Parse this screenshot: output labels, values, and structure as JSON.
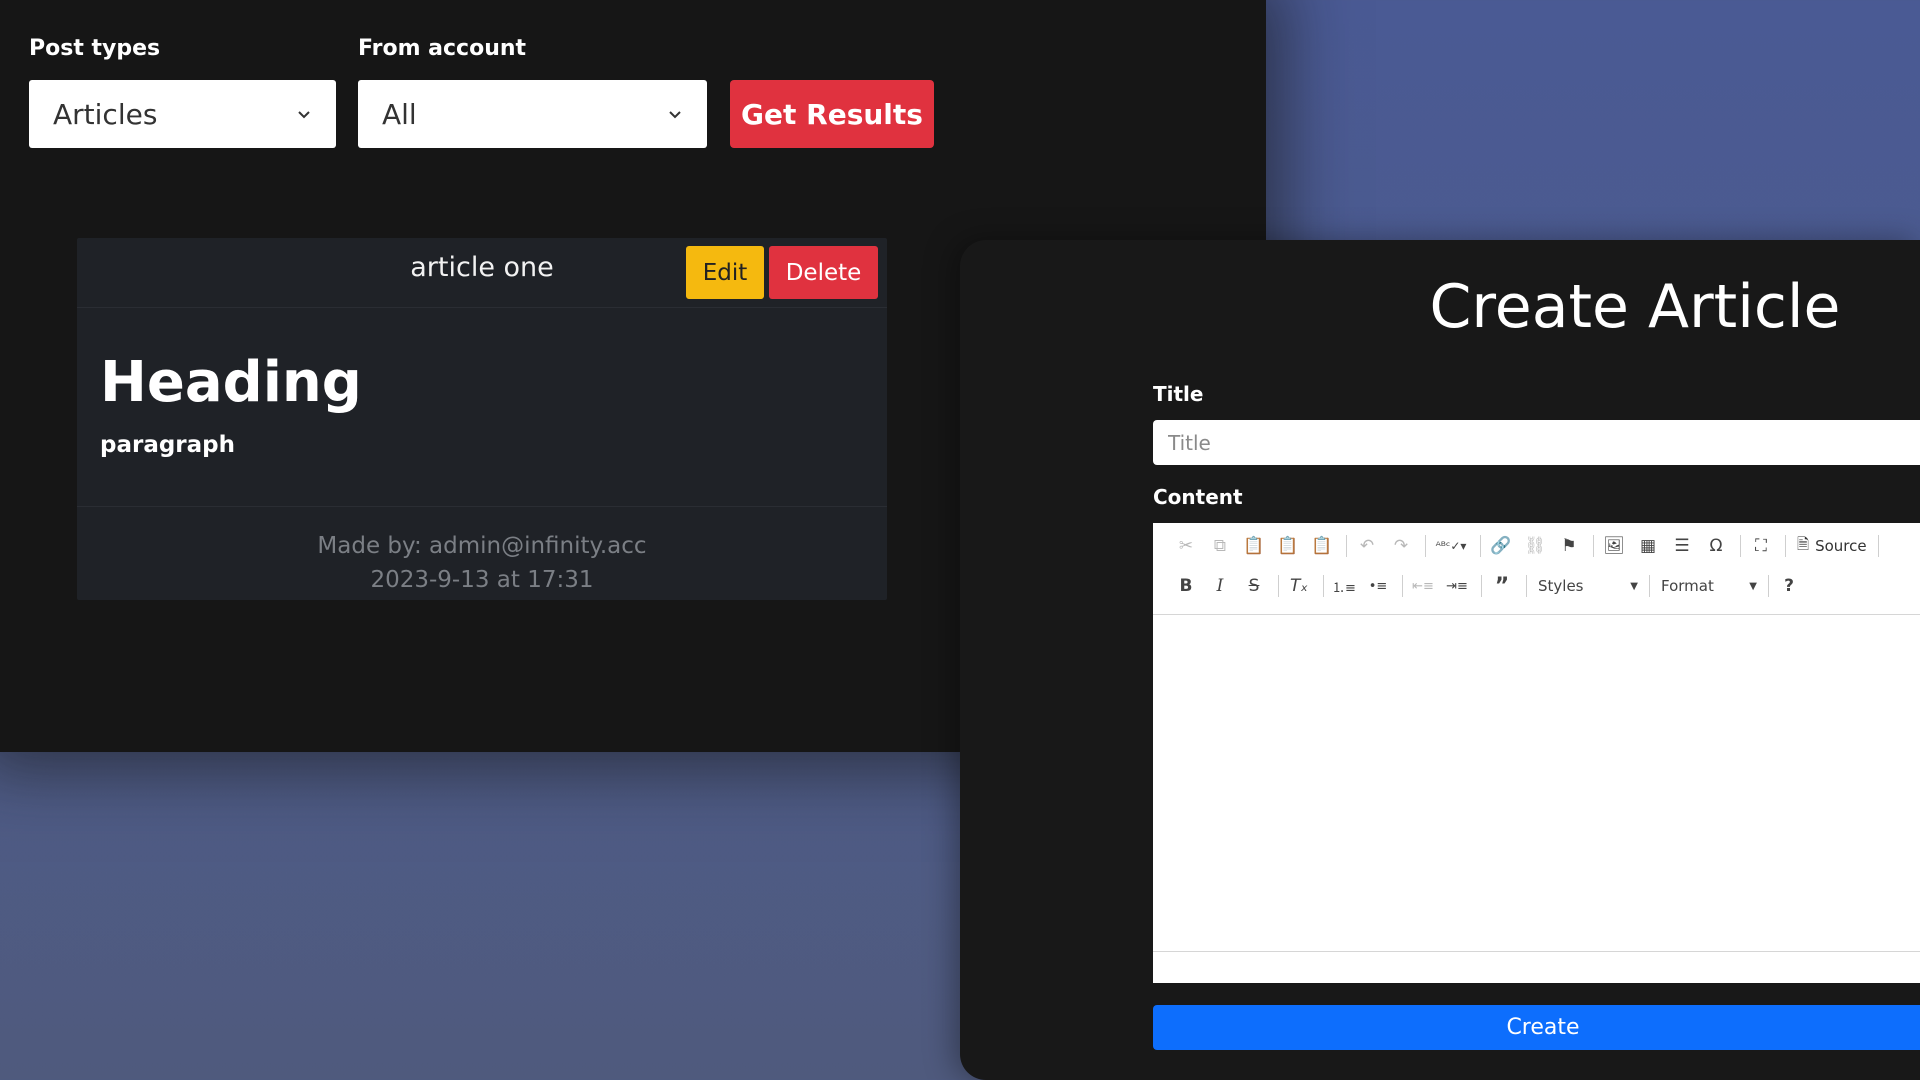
{
  "filters": {
    "post_types_label": "Post types",
    "post_types_value": "Articles",
    "from_account_label": "From account",
    "from_account_value": "All",
    "get_results_label": "Get Results"
  },
  "article_card": {
    "title": "article one",
    "edit_label": "Edit",
    "delete_label": "Delete",
    "heading": "Heading",
    "paragraph": "paragraph",
    "made_by": "Made by: admin@infinity.acc",
    "date": "2023-9-13 at 17:31"
  },
  "create_modal": {
    "title": "Create Article",
    "title_label": "Title",
    "title_placeholder": "Title",
    "content_label": "Content",
    "create_label": "Create",
    "toolbar": {
      "source_label": "Source",
      "styles_label": "Styles",
      "format_label": "Format"
    }
  },
  "colors": {
    "danger": "#e0323f",
    "warning": "#f5b90f",
    "primary": "#0d6efd",
    "panel": "#161616",
    "backdrop": "#4a5a94"
  }
}
